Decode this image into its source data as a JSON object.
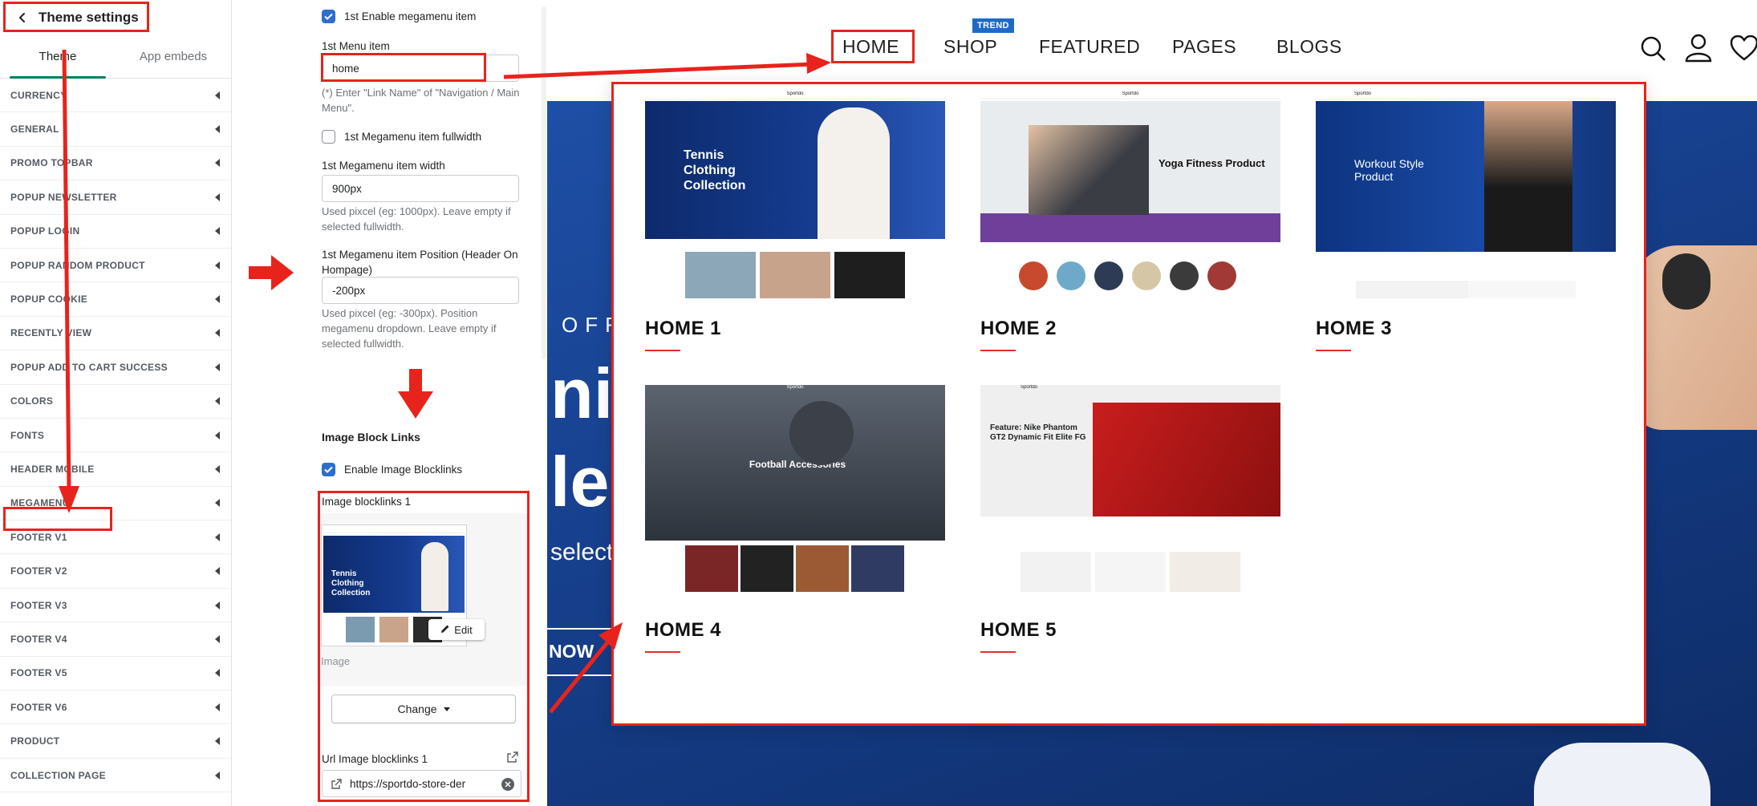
{
  "sidebar": {
    "title": "Theme settings",
    "tabs": [
      {
        "label": "Theme"
      },
      {
        "label": "App embeds"
      }
    ],
    "items": [
      {
        "label": "CURRENCY"
      },
      {
        "label": "GENERAL"
      },
      {
        "label": "PROMO TOPBAR"
      },
      {
        "label": "POPUP NEWSLETTER"
      },
      {
        "label": "POPUP LOGIN"
      },
      {
        "label": "POPUP RANDOM PRODUCT"
      },
      {
        "label": "POPUP COOKIE"
      },
      {
        "label": "RECENTLY VIEW"
      },
      {
        "label": "POPUP ADD TO CART SUCCESS"
      },
      {
        "label": "COLORS"
      },
      {
        "label": "FONTS"
      },
      {
        "label": "HEADER MOBILE"
      },
      {
        "label": "MEGAMENU"
      },
      {
        "label": "FOOTER V1"
      },
      {
        "label": "FOOTER V2"
      },
      {
        "label": "FOOTER V3"
      },
      {
        "label": "FOOTER V4"
      },
      {
        "label": "FOOTER V5"
      },
      {
        "label": "FOOTER V6"
      },
      {
        "label": "PRODUCT"
      },
      {
        "label": "COLLECTION PAGE"
      }
    ]
  },
  "panel": {
    "enable_item_label": "1st Enable megamenu item",
    "menu_item_label": "1st Menu item",
    "menu_item_value": "home",
    "menu_item_help": "(*) Enter \"Link Name\" of \"Navigation / Main Menu\".",
    "fullwidth_label": "1st Megamenu item fullwidth",
    "width_label": "1st Megamenu item width",
    "width_value": "900px",
    "width_help": "Used pixcel (eg: 1000px). Leave empty if selected fullwidth.",
    "position_label": "1st Megamenu item Position (Header On Hompage)",
    "position_value": "-200px",
    "position_help": "Used pixcel (eg: -300px). Position megamenu dropdown. Leave empty if selected fullwidth.",
    "section_heading": "Image Block Links",
    "enable_blocklinks_label": "Enable Image Blocklinks",
    "blocklinks_title": "Image blocklinks 1",
    "thumb_title": "Tennis Clothing Collection",
    "edit_label": "Edit",
    "image_label": "Image",
    "change_label": "Change",
    "url_label": "Url Image blocklinks 1",
    "url_value": "https://sportdo-store-der"
  },
  "store": {
    "nav": [
      {
        "label": "HOME"
      },
      {
        "label": "SHOP"
      },
      {
        "label": "FEATURED"
      },
      {
        "label": "PAGES"
      },
      {
        "label": "BLOGS"
      }
    ],
    "badge": "TREND",
    "hero_offer": "OFF",
    "hero_line1": "ni",
    "hero_line2": "le",
    "hero_select": "select",
    "hero_now": "NOW",
    "demos": [
      {
        "title": "HOME 1",
        "headline": "Tennis Clothing Collection"
      },
      {
        "title": "HOME 2",
        "headline": "Yoga Fitness Product"
      },
      {
        "title": "HOME 3",
        "headline": "Workout Style Product"
      },
      {
        "title": "HOME 4",
        "headline": "Football Accessories"
      },
      {
        "title": "HOME 5",
        "headline": "Feature: Nike Phantom GT2 Dynamic Fit Elite FG"
      }
    ],
    "mini_logo": "Sportdo"
  },
  "colors": {
    "annotation_red": "#e8231c",
    "accent_green": "#008060",
    "checkbox_blue": "#2c6ecb",
    "hero_blue": "#1a4a9c"
  }
}
